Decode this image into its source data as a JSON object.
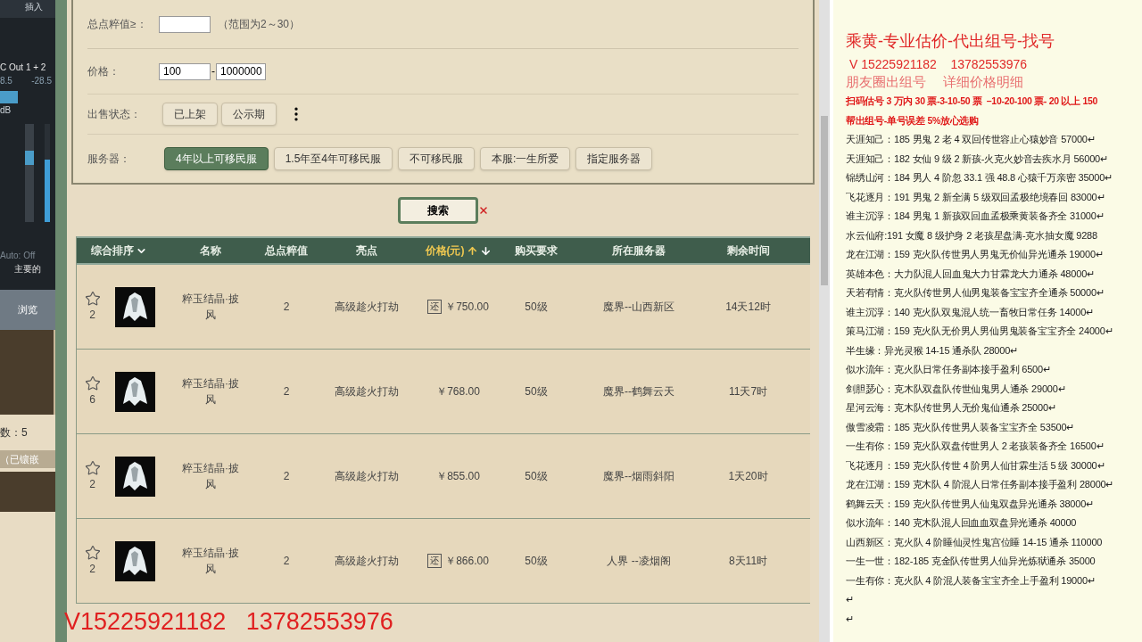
{
  "mixer": {
    "insert": "插入",
    "channel": "C Out 1 + 2",
    "readings": [
      "8.5",
      "-28.5"
    ],
    "unit": "dB",
    "auto": "Auto: Off",
    "bus": "主要的",
    "browse": "浏览",
    "count": "数：5",
    "embed": "（已镶嵌"
  },
  "filters": {
    "points": {
      "label": "总点粹值≥：",
      "hint": "（范围为2～30）"
    },
    "price": {
      "label": "价格：",
      "min": "100",
      "separator": "-",
      "max": "1000000"
    },
    "status": {
      "label": "出售状态：",
      "options": [
        {
          "label": "已上架",
          "selected": false
        },
        {
          "label": "公示期",
          "selected": false
        }
      ]
    },
    "server": {
      "label": "服务器：",
      "options": [
        {
          "label": "4年以上可移民服",
          "selected": true
        },
        {
          "label": "1.5年至4年可移民服",
          "selected": false
        },
        {
          "label": "不可移民服",
          "selected": false
        },
        {
          "label": "本服:一生所爱",
          "selected": false
        },
        {
          "label": "指定服务器",
          "selected": false
        }
      ]
    }
  },
  "search_button": "搜索",
  "table": {
    "columns": [
      {
        "label": "综合排序",
        "kind": "dropdown",
        "selected": false
      },
      {
        "label": "名称",
        "kind": "plain",
        "selected": false
      },
      {
        "label": "总点粹值",
        "kind": "plain",
        "selected": false
      },
      {
        "label": "亮点",
        "kind": "plain",
        "selected": false
      },
      {
        "label": "价格(元)",
        "kind": "sort",
        "selected": true
      },
      {
        "label": "购买要求",
        "kind": "plain",
        "selected": false
      },
      {
        "label": "所在服务器",
        "kind": "plain",
        "selected": false
      },
      {
        "label": "剩余时间",
        "kind": "plain",
        "selected": false
      }
    ],
    "rows": [
      {
        "favorites": "2",
        "name": "粹玉结晶·披风",
        "points": "2",
        "highlight": "高级趁火打劫",
        "badge": "还",
        "price": "￥750.00",
        "requirement": "50级",
        "server": "魔界--山西新区",
        "time": "14天12时"
      },
      {
        "favorites": "6",
        "name": "粹玉结晶·披风",
        "points": "2",
        "highlight": "高级趁火打劫",
        "price": "￥768.00",
        "requirement": "50级",
        "server": "魔界--鹤舞云天",
        "time": "11天7时"
      },
      {
        "favorites": "2",
        "name": "粹玉结晶·披风",
        "points": "2",
        "highlight": "高级趁火打劫",
        "price": "￥855.00",
        "requirement": "50级",
        "server": "魔界--烟雨斜阳",
        "time": "1天20时"
      },
      {
        "favorites": "2",
        "name": "粹玉结晶·披风",
        "points": "2",
        "highlight": "高级趁火打劫",
        "badge": "还",
        "price": "￥866.00",
        "requirement": "50级",
        "server": "人界 --凌烟阁",
        "time": "8天11时"
      }
    ]
  },
  "overlay": "V15225921182   13782553976",
  "doc": {
    "heading": "乘黄-专业估价-代出组号-找号",
    "contact": "V 15225921182    13782553976",
    "subtitle": "朋友圈出组号    详细价格明细",
    "notice": [
      "扫码估号 3 万内 30 票-3-10-50 票  –10-20-100 票- 20 以上 150",
      "帮出组号-单号误差 5%放心选购"
    ],
    "lines": [
      "天涯知己：185 男鬼 2 老 4 双回传世容止心猿妙音 57000↵",
      "天涯知己：182 女仙 9 级 2 新孩-火克火妙音去疾水月 56000↵",
      "锦绣山河：184 男人 4 阶忽 33.1 强 48.8 心猿千万亲密 35000↵",
      "飞花逐月：191 男鬼 2 新全满 5 级双回孟极绝境春回 83000↵",
      "谁主沉浮：184 男鬼 1 新孩双回血孟极乘黄装备齐全 31000↵",
      "水云仙府:191 女魔 8 级护身 2 老孩星盘满-克水抽女魔 9288",
      "龙在江湖：159 克火队传世男人男鬼无价仙异光通杀 19000↵",
      "英雄本色：大力队混人回血鬼大力甘霖龙大力通杀 48000↵",
      "天若有情：克火队传世男人仙男鬼装备宝宝齐全通杀 50000↵",
      "谁主沉浮：140 克火队双鬼混人统一畜牧日常任务 14000↵",
      "策马江湖：159 克火队无价男人男仙男鬼装备宝宝齐全 24000↵",
      "半生缘：异光灵猴 14-15 通杀队 28000↵",
      "似水流年：克火队日常任务副本接手盈利 6500↵",
      "剑胆瑟心：克木队双盘队传世仙鬼男人通杀 29000↵",
      "星河云海：克木队传世男人无价鬼仙通杀 25000↵",
      "傲雪凌霜：185 克火队传世男人装备宝宝齐全 53500↵",
      "一生有你：159 克火队双盘传世男人 2 老孩装备齐全 16500↵",
      "飞花逐月：159 克火队传世 4 阶男人仙甘霖生活 5 级 30000↵",
      "龙在江湖：159 克木队 4 阶混人日常任务副本接手盈利 28000↵",
      "鹤舞云天：159 克火队传世男人仙鬼双盘异光通杀 38000↵",
      "似水流年：140 克木队混人回血血双盘异光通杀 40000",
      "山西新区：克火队 4 阶睡仙灵性鬼宫位睡 14-15 通杀 110000",
      "一生一世：182-185 克金队传世男人仙异光炼狱通杀 35000",
      "一生有你：克火队 4 阶混人装备宝宝齐全上手盈利 19000↵",
      "↵",
      "↵"
    ]
  }
}
